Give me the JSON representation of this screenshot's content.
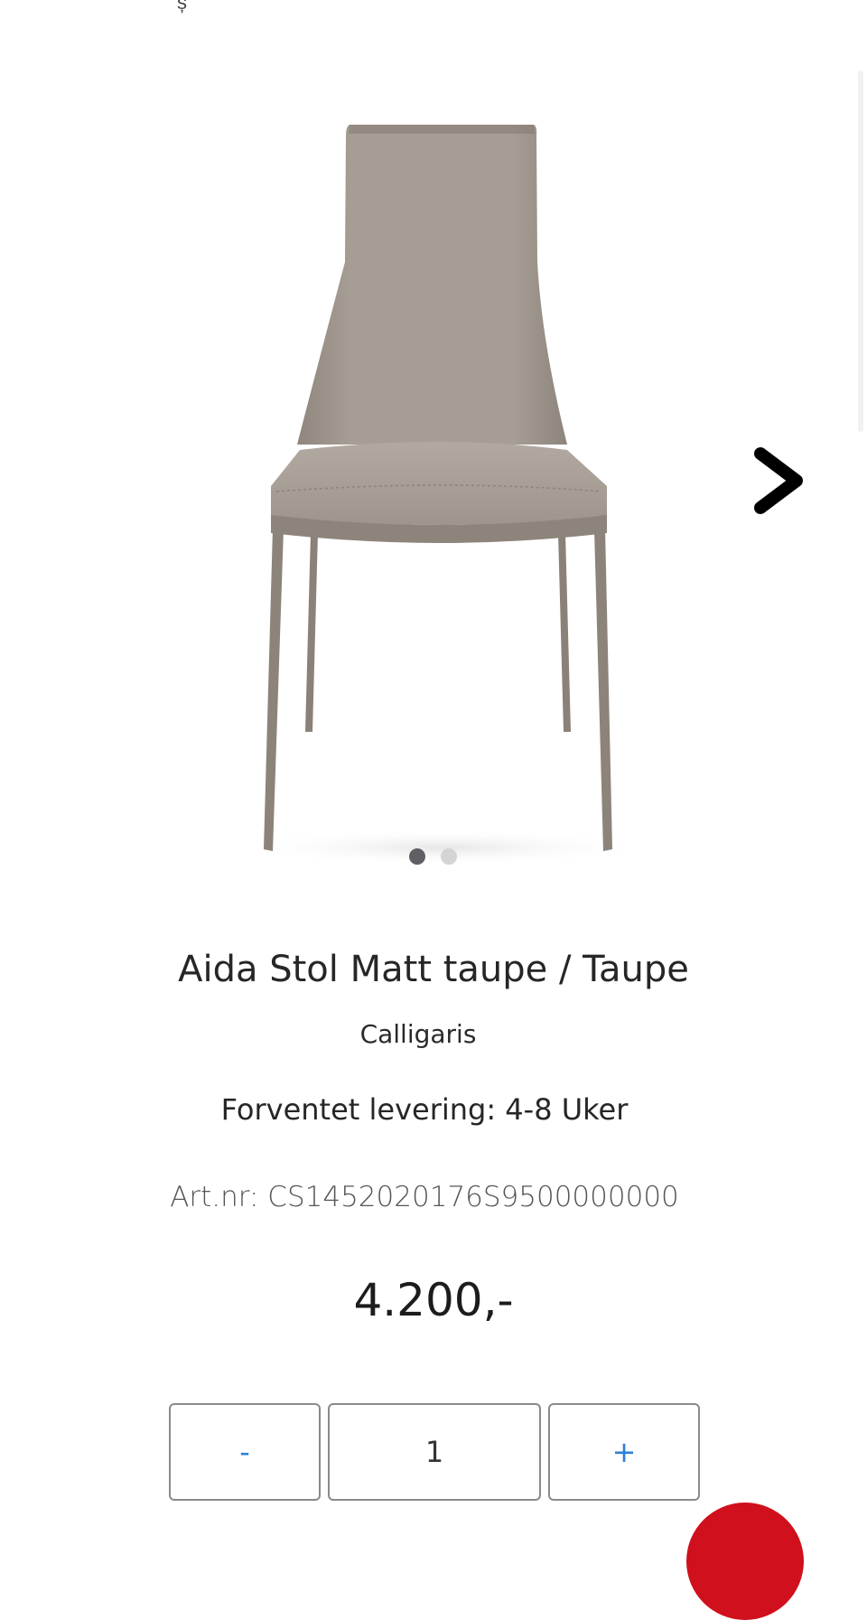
{
  "product": {
    "title": "Aida Stol Matt taupe / Taupe",
    "brand": "Calligaris",
    "delivery": "Forventet levering: 4-8 Uker",
    "article_number": "Art.nr: CS1452020176S9500000000",
    "price": "4.200,-"
  },
  "gallery": {
    "image_count": 2,
    "active_index": 0
  },
  "quantity": {
    "minus_label": "-",
    "value": "1",
    "plus_label": "+"
  },
  "colors": {
    "accent_blue": "#2b7fd6",
    "fab_red": "#d0101c",
    "chair_taupe": "#a39a91"
  }
}
